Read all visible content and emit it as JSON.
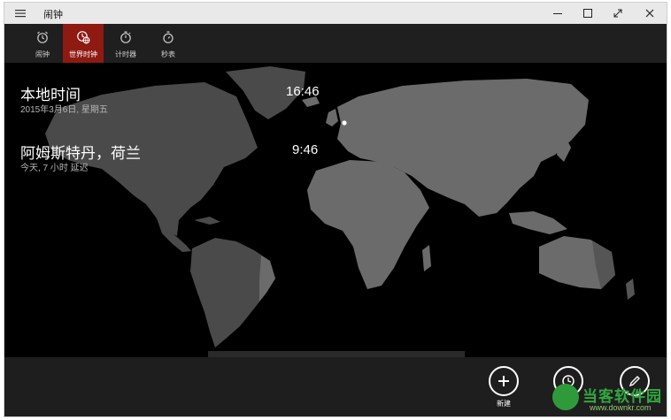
{
  "titlebar": {
    "title": "闹钟",
    "icons": [
      "hamburger-icon",
      "minimize-icon",
      "maximize-icon",
      "fullscreen-icon",
      "close-icon"
    ]
  },
  "tabs": [
    {
      "label": "闹钟",
      "icon": "alarm-icon",
      "active": false
    },
    {
      "label": "世界时钟",
      "icon": "world-clock-icon",
      "active": true
    },
    {
      "label": "计时器",
      "icon": "timer-icon",
      "active": false
    },
    {
      "label": "秒表",
      "icon": "stopwatch-icon",
      "active": false
    }
  ],
  "clocks": [
    {
      "name": "本地时间",
      "subtitle": "2015年3月6日, 星期五",
      "time": "16:46"
    },
    {
      "name": "阿姆斯特丹，荷兰",
      "subtitle": "今天, 7 小时 延迟",
      "time": "9:46"
    }
  ],
  "actions": [
    {
      "label": "新建",
      "icon": "plus-icon"
    },
    {
      "label": "",
      "icon": "compare-clock-icon"
    },
    {
      "label": "",
      "icon": "edit-pencil-icon"
    }
  ],
  "watermark": {
    "text": "当客软件园",
    "url": "www.downkr.com"
  },
  "colors": {
    "active_tab": "#8e1a12",
    "land": "#4a4a4a",
    "land_day": "#6b6b6b",
    "background": "#000000"
  }
}
